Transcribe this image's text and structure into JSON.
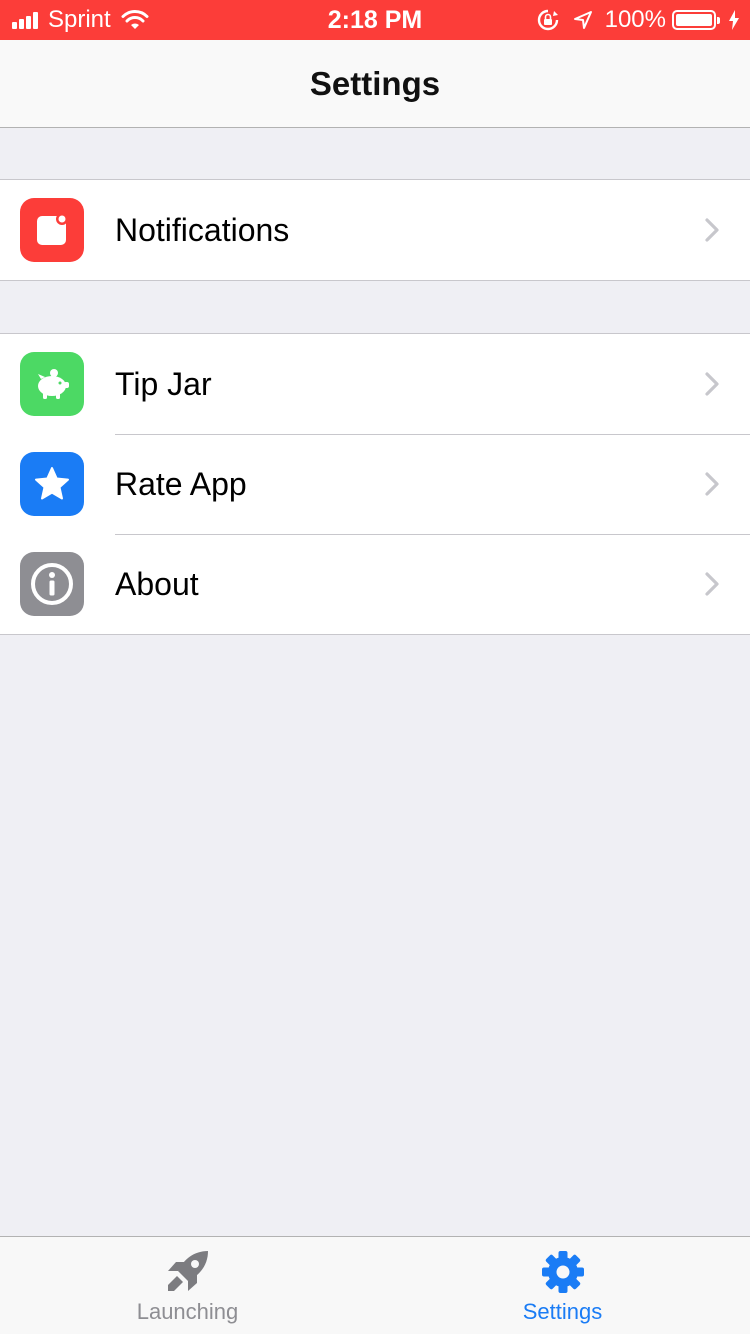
{
  "status_bar": {
    "carrier": "Sprint",
    "time": "2:18 PM",
    "battery_percent": "100%",
    "background_color": "#fc3d39"
  },
  "nav": {
    "title": "Settings"
  },
  "groups": [
    {
      "items": [
        {
          "label": "Notifications",
          "icon": "notification-badge-icon",
          "icon_color": "#fc3d39"
        }
      ]
    },
    {
      "items": [
        {
          "label": "Tip Jar",
          "icon": "piggy-bank-icon",
          "icon_color": "#4cd964"
        },
        {
          "label": "Rate App",
          "icon": "star-icon",
          "icon_color": "#1a7cf5"
        },
        {
          "label": "About",
          "icon": "info-icon",
          "icon_color": "#8e8e93"
        }
      ]
    }
  ],
  "tab_bar": {
    "tabs": [
      {
        "label": "Launching",
        "icon": "rocket-icon",
        "active": false
      },
      {
        "label": "Settings",
        "icon": "gear-icon",
        "active": true
      }
    ],
    "active_color": "#1a7cf5",
    "inactive_color": "#8e8e93"
  }
}
